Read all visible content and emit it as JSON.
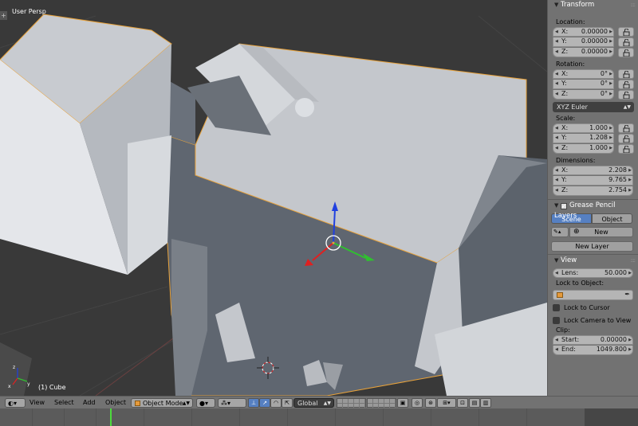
{
  "viewport": {
    "view_name": "User Persp",
    "object_label": "(1) Cube",
    "corner_symbol": "+"
  },
  "transform": {
    "title": "Transform",
    "location_label": "Location:",
    "location": [
      {
        "axis": "X:",
        "value": "0.00000"
      },
      {
        "axis": "Y:",
        "value": "0.00000"
      },
      {
        "axis": "Z:",
        "value": "0.00000"
      }
    ],
    "rotation_label": "Rotation:",
    "rotation": [
      {
        "axis": "X:",
        "value": "0°"
      },
      {
        "axis": "Y:",
        "value": "0°"
      },
      {
        "axis": "Z:",
        "value": "0°"
      }
    ],
    "rotation_mode": "XYZ Euler",
    "scale_label": "Scale:",
    "scale": [
      {
        "axis": "X:",
        "value": "1.000"
      },
      {
        "axis": "Y:",
        "value": "1.208"
      },
      {
        "axis": "Z:",
        "value": "1.000"
      }
    ],
    "dimensions_label": "Dimensions:",
    "dimensions": [
      {
        "axis": "X:",
        "value": "2.208"
      },
      {
        "axis": "Y:",
        "value": "9.765"
      },
      {
        "axis": "Z:",
        "value": "2.754"
      }
    ]
  },
  "grease_pencil": {
    "title": "Grease Pencil Layers",
    "tab_scene": "Scene",
    "tab_object": "Object",
    "new_label": "New",
    "new_layer_label": "New Layer"
  },
  "view_panel": {
    "title": "View",
    "lens_label": "Lens:",
    "lens_value": "50.000",
    "lock_to_object_label": "Lock to Object:",
    "lock_to_cursor_label": "Lock to Cursor",
    "lock_camera_label": "Lock Camera to View",
    "clip_label": "Clip:",
    "clip_start_label": "Start:",
    "clip_start_value": "0.00000",
    "clip_end_label": "End:",
    "clip_end_value": "1049.800"
  },
  "header": {
    "menu_view": "View",
    "menu_select": "Select",
    "menu_add": "Add",
    "menu_object": "Object",
    "mode": "Object Mode",
    "orientation": "Global"
  },
  "icons": [
    "editor-type-icon",
    "shading-sphere-icon",
    "pivot-icon",
    "manipulator-icon",
    "translate-icon",
    "rotate-icon",
    "scale-icon",
    "lock-icon",
    "cube-icon",
    "eyedropper-icon",
    "snap-icon",
    "render-icon"
  ],
  "colors": {
    "panel_bg": "#727272",
    "viewport_bg": "#393939",
    "active_tab": "#5680c2",
    "selection_outline": "#e8a23a",
    "axis_x": "#e02020",
    "axis_y": "#30c030",
    "axis_z": "#2040e0",
    "frame_marker": "#4dda3c"
  }
}
